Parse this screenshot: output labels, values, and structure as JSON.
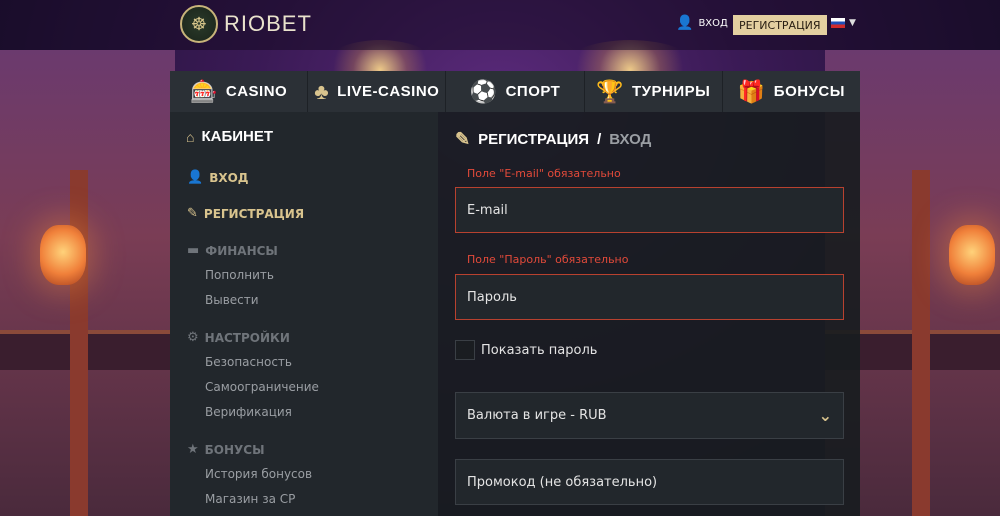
{
  "header": {
    "brand": "RIOBET",
    "login_label": "ВХОД",
    "register_label": "РЕГИСТРАЦИЯ"
  },
  "nav": {
    "items": [
      {
        "label": "CASINO",
        "icon": "slot-machine-icon"
      },
      {
        "label": "LIVE-CASINO",
        "icon": "chips-icon"
      },
      {
        "label": "СПОРТ",
        "icon": "soccer-ball-icon"
      },
      {
        "label": "ТУРНИРЫ",
        "icon": "trophy-icon"
      },
      {
        "label": "БОНУСЫ",
        "icon": "gift-icon"
      }
    ]
  },
  "sidebar": {
    "title": "КАБИНЕТ",
    "login": "ВХОД",
    "register": "РЕГИСТРАЦИЯ",
    "finance": {
      "label": "ФИНАНСЫ",
      "items": [
        "Пополнить",
        "Вывести"
      ]
    },
    "settings": {
      "label": "НАСТРОЙКИ",
      "items": [
        "Безопасность",
        "Самоограничение",
        "Верификация"
      ]
    },
    "bonuses": {
      "label": "БОНУСЫ",
      "items": [
        "История бонусов",
        "Магазин за CP"
      ]
    }
  },
  "form": {
    "title": "РЕГИСТРАЦИЯ",
    "title_sep": "/",
    "title_alt": "ВХОД",
    "email_error": "Поле \"E-mail\" обязательно",
    "email_placeholder": "E-mail",
    "password_error": "Поле \"Пароль\" обязательно",
    "password_placeholder": "Пароль",
    "show_password_label": "Показать пароль",
    "currency_value": "Валюта в игре - RUB",
    "promo_placeholder": "Промокод (не обязательно)"
  },
  "colors": {
    "accent": "#d9c48e",
    "error": "#e24a3a",
    "panel": "#22272c"
  }
}
